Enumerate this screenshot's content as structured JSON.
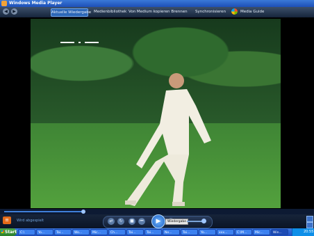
{
  "window": {
    "title": "Windows Media Player"
  },
  "nav": {
    "back_label": "◀",
    "forward_label": "▶",
    "tabs": [
      {
        "label": "Aktuelle Wiedergabe",
        "active": true
      },
      {
        "label": "Medienbibliothek"
      },
      {
        "label": "Von Medium kopieren"
      },
      {
        "label": "Brennen"
      },
      {
        "label": "Synchronisieren"
      },
      {
        "label": "Media Guide"
      }
    ]
  },
  "video": {
    "osd_text": "— · —",
    "description": "tai chi practitioner in white outdoors"
  },
  "playback": {
    "progress_fraction": 0.26,
    "status_text": "Wird abgespielt",
    "tooltip": "Wiedergabe",
    "volume_fraction": 0.82,
    "play_symbol": "▶",
    "prev_symbol": "⏮",
    "next_symbol": "⏭",
    "stop_symbol": "■",
    "rew_symbol": "◀◀",
    "ffw_symbol": "▶▶"
  },
  "taskbar": {
    "start_label": "Start",
    "tasks": [
      {
        "label": "C:\\"
      },
      {
        "label": "Yo..."
      },
      {
        "label": "Tai..."
      },
      {
        "label": "Wo..."
      },
      {
        "label": "Mic..."
      },
      {
        "label": "Ch..."
      },
      {
        "label": "Tai..."
      },
      {
        "label": "Tai..."
      },
      {
        "label": "Ne..."
      },
      {
        "label": "Tai..."
      },
      {
        "label": "Yo..."
      },
      {
        "label": "xxx..."
      },
      {
        "label": "C:\\M..."
      },
      {
        "label": "Mic..."
      },
      {
        "label": "Win...",
        "active": true
      }
    ],
    "clock": "20:55"
  },
  "colors": {
    "accent": "#2c67b7",
    "chrome_dark": "#0a1425",
    "orange": "#e46a18"
  }
}
